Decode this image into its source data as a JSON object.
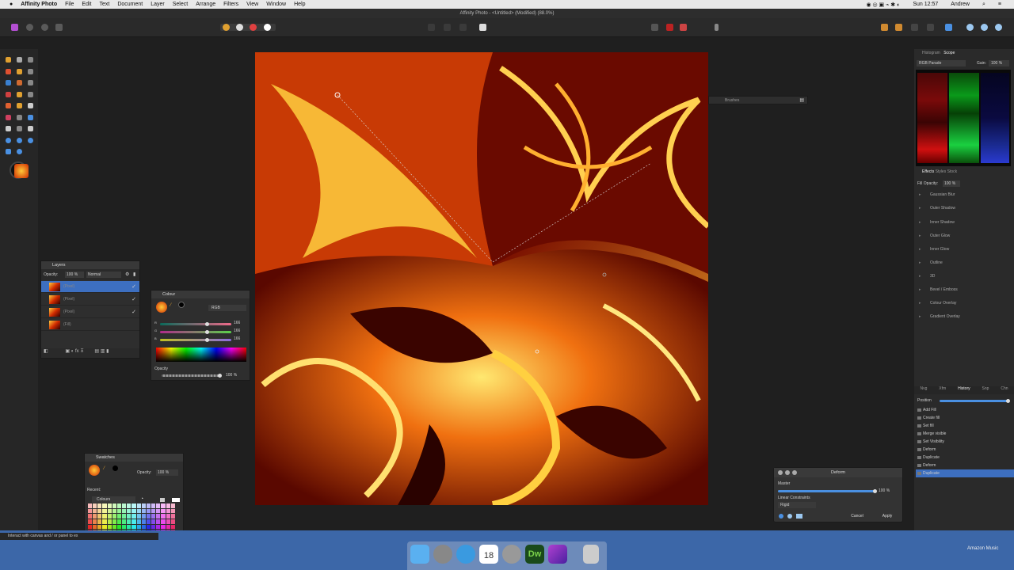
{
  "menubar": {
    "app": "Affinity Photo",
    "items": [
      "File",
      "Edit",
      "Text",
      "Document",
      "Layer",
      "Select",
      "Arrange",
      "Filters",
      "View",
      "Window",
      "Help"
    ],
    "clock": "Sun 12:57",
    "user": "Andrew"
  },
  "window": {
    "title": "Affinity Photo - <Untitled> (Modified) (88.0%)"
  },
  "layers": {
    "tab": "Layers",
    "opacity_label": "Opacity:",
    "opacity": "100 %",
    "blend": "Normal",
    "items": [
      "(Pixel)",
      "(Pixel)",
      "(Pixel)",
      "(Fill)"
    ]
  },
  "colour": {
    "tab": "Colour",
    "model": "RGB",
    "r": "166",
    "g": "166",
    "b": "166",
    "r_label": "R",
    "g_label": "G",
    "b_label": "B",
    "opacity_label": "Opacity",
    "opacity": "100 %"
  },
  "brushes": {
    "tab": "Brushes"
  },
  "swatches": {
    "tab": "Swatches",
    "opacity_label": "Opacity:",
    "opacity": "100 %",
    "recent_label": "Recent:",
    "palette": "Colours"
  },
  "histogram": {
    "tabs": [
      "Histogram",
      "Scope"
    ],
    "mode": "RGB Parade",
    "gain_label": "Gain:",
    "gain": "100 %"
  },
  "effects": {
    "tabs": [
      "Effects",
      "Styles",
      "Stock"
    ],
    "fill_opacity_label": "Fill Opacity:",
    "fill_opacity": "100 %",
    "items": [
      "Gaussian Blur",
      "Outer Shadow",
      "Inner Shadow",
      "Outer Glow",
      "Inner Glow",
      "Outline",
      "3D",
      "Bevel / Emboss",
      "Colour Overlay",
      "Gradient Overlay"
    ]
  },
  "history": {
    "tabs": [
      "Nvg",
      "Xfm",
      "History",
      "Snp",
      "Chn"
    ],
    "position_label": "Position",
    "items": [
      "Add Fill",
      "Create fill",
      "Set fill",
      "Merge visible",
      "Set Visibility",
      "Deform",
      "Duplicate",
      "Deform",
      "Duplicate"
    ]
  },
  "deform": {
    "title": "Deform",
    "master_label": "Master",
    "master": "100 %",
    "linear_label": "Linear Constraints",
    "linear_value": "Rigid",
    "cancel": "Cancel",
    "apply": "Apply"
  },
  "status": {
    "text": "Interact with canvas and / or panel to ex"
  },
  "dock": {
    "right_label": "Amazon Music",
    "calendar_day": "18"
  }
}
